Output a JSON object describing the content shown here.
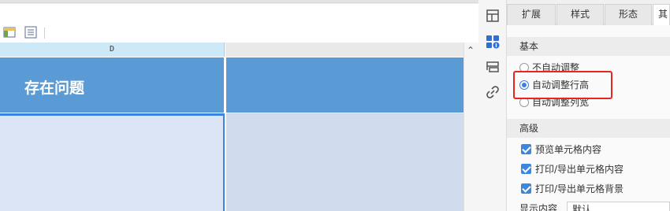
{
  "sheet": {
    "column_headers": [
      "D",
      ""
    ],
    "header_cell_text": "存在问题",
    "scroll_up_glyph": "⌃"
  },
  "panel": {
    "tabs": [
      "扩展",
      "样式",
      "形态",
      "其"
    ],
    "basic_section": {
      "title": "基本",
      "options": [
        "不自动调整",
        "自动调整行高",
        "自动调整列宽"
      ],
      "selected_index": 1
    },
    "advanced_section": {
      "title": "高级",
      "checkboxes": [
        "预览单元格内容",
        "打印/导出单元格内容",
        "打印/导出单元格背景"
      ]
    },
    "display": {
      "label": "显示内容",
      "value": "默认"
    }
  },
  "colors": {
    "header_fill": "#5b9bd5",
    "selection_border": "#3c82e0",
    "highlight_box": "#e8251f",
    "accent": "#3d86de"
  }
}
